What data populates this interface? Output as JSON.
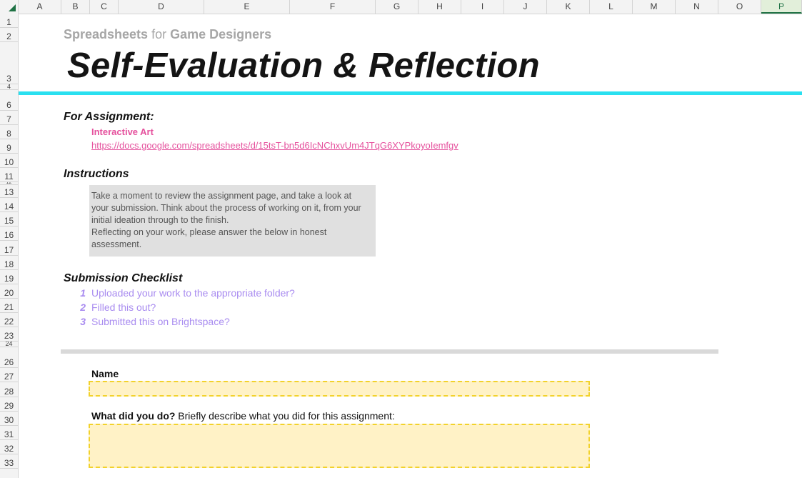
{
  "columns": [
    "A",
    "B",
    "C",
    "D",
    "E",
    "F",
    "G",
    "H",
    "I",
    "J",
    "K",
    "L",
    "M",
    "N",
    "O",
    "P"
  ],
  "active_column": "P",
  "rows": [
    "1",
    "2",
    "3",
    "4",
    "6",
    "7",
    "8",
    "9",
    "10",
    "11",
    "12",
    "13",
    "14",
    "15",
    "16",
    "17",
    "18",
    "19",
    "20",
    "21",
    "22",
    "23",
    "24",
    "26",
    "27",
    "28",
    "29",
    "30",
    "31",
    "32",
    "33"
  ],
  "header": {
    "subtitle_left": "Spreadsheets",
    "subtitle_mid": "for",
    "subtitle_right": "Game Designers",
    "title": "Self-Evaluation & Reflection"
  },
  "assignment": {
    "heading": "For Assignment:",
    "name": "Interactive Art",
    "url": "https://docs.google.com/spreadsheets/d/15tsT-bn5d6IcNChxvUm4JTqG6XYPkoyoIemfgv"
  },
  "instructions": {
    "heading": "Instructions",
    "line1": "Take a moment to review the assignment page, and take a look at",
    "line2": "your submission. Think about the process of working on it, from your",
    "line3": "initial ideation through to the finish.",
    "line4": "Reflecting on your work, please answer the below in honest",
    "line5": "assessment."
  },
  "checklist": {
    "heading": "Submission Checklist",
    "items": [
      {
        "num": "1",
        "text": "Uploaded your work to the appropriate folder?"
      },
      {
        "num": "2",
        "text": "Filled this out?"
      },
      {
        "num": "3",
        "text": "Submitted this on Brightspace?"
      }
    ]
  },
  "form": {
    "name_label": "Name",
    "q1_bold": "What did you do?",
    "q1_rest": " Briefly describe what you did for this assignment:"
  },
  "colors": {
    "cyan": "#2ae0f0",
    "pink": "#e5519d",
    "purple": "#a98cf0",
    "field_fill": "#fff2c6",
    "field_border": "#f2d22c",
    "excel_green": "#217346"
  }
}
